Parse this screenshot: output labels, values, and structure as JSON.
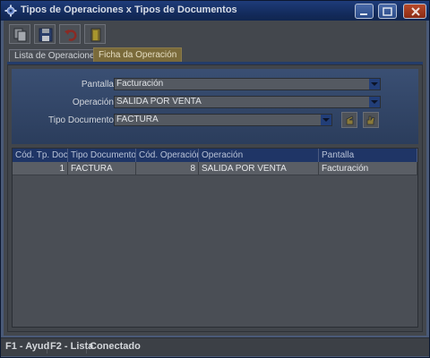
{
  "window": {
    "title": "Tipos de Operaciones x Tipos de Documentos"
  },
  "toolbar": {
    "items": [
      "copy-icon",
      "save-icon",
      "undo-icon",
      "exit-icon"
    ]
  },
  "tabs": [
    {
      "label": "Lista de Operaciones",
      "active": false
    },
    {
      "label": "Ficha da Operación",
      "active": true
    }
  ],
  "form": {
    "pantalla": {
      "label": "Pantalla",
      "value": "Facturación"
    },
    "operacion": {
      "label": "Operación",
      "value": "SALIDA POR VENTA"
    },
    "tipo_documento": {
      "label": "Tipo Documento",
      "value": "FACTURA"
    }
  },
  "grid": {
    "columns": [
      "Cód. Tp. Doc.",
      "Tipo Documento",
      "Cód. Operación",
      "Operación",
      "Pantalla"
    ],
    "rows": [
      [
        "1",
        "FACTURA",
        "8",
        "SALIDA POR VENTA",
        "Facturación"
      ]
    ]
  },
  "status": {
    "help": "F1 - Ayud",
    "list": "F2 - Lista",
    "connection": "Conectado"
  },
  "colors": {
    "titlebar": "#1e3c7a",
    "form_bg": "#3a4f73",
    "active_tab": "#7a6a3a",
    "grid_header": "#1f3566"
  }
}
